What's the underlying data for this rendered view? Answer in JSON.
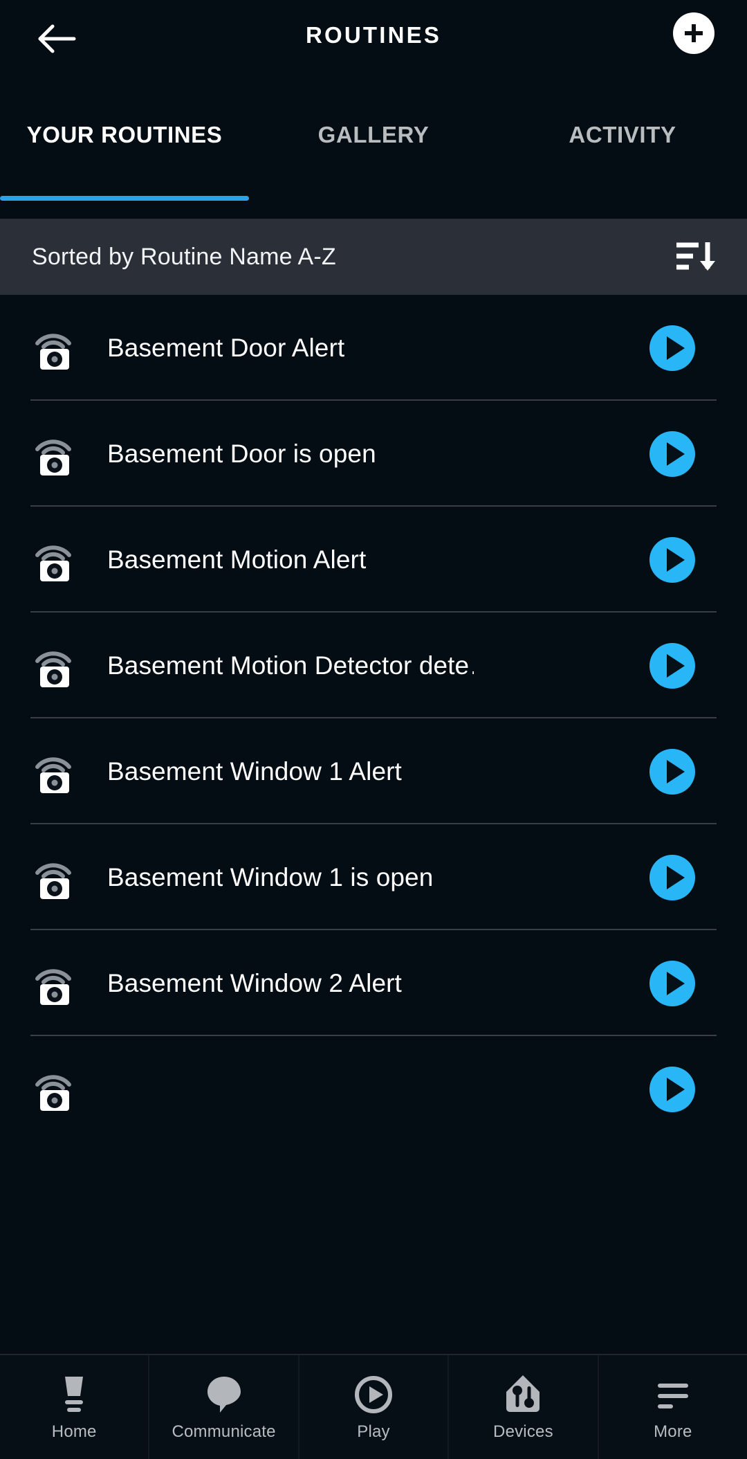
{
  "header": {
    "title": "ROUTINES",
    "back_icon": "arrow-left-icon",
    "add_icon": "plus-icon"
  },
  "tabs": [
    {
      "label": "YOUR ROUTINES",
      "active": true
    },
    {
      "label": "GALLERY",
      "active": false
    },
    {
      "label": "ACTIVITY",
      "active": false
    }
  ],
  "sortbar": {
    "text": "Sorted by Routine Name A-Z",
    "icon": "sort-descending-icon"
  },
  "routines": [
    {
      "name": "Basement Door Alert"
    },
    {
      "name": "Basement Door is open"
    },
    {
      "name": "Basement Motion Alert"
    },
    {
      "name": "Basement Motion Detector dete…"
    },
    {
      "name": "Basement Window 1 Alert"
    },
    {
      "name": "Basement Window 1 is open"
    },
    {
      "name": "Basement Window 2 Alert"
    },
    {
      "name": ""
    }
  ],
  "bottom_nav": [
    {
      "label": "Home",
      "icon": "lamp-icon"
    },
    {
      "label": "Communicate",
      "icon": "speech-bubble-icon"
    },
    {
      "label": "Play",
      "icon": "play-circle-icon"
    },
    {
      "label": "Devices",
      "icon": "home-devices-icon"
    },
    {
      "label": "More",
      "icon": "hamburger-menu-icon"
    }
  ],
  "colors": {
    "background": "#040d14",
    "sortbar_bg": "#2b2f38",
    "accent_blue": "#29b6f6",
    "tab_underline": "#2aa3e8",
    "muted_text": "#b9bdc0"
  }
}
